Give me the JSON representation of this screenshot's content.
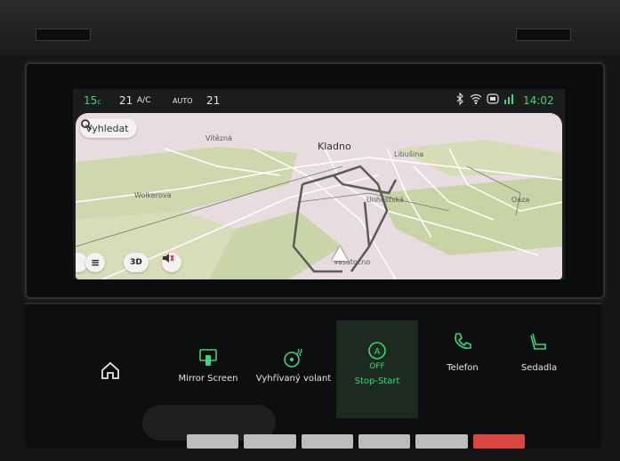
{
  "status_bar": {
    "outside_temp": "15",
    "outside_temp_unit": "c",
    "driver_temp": "21",
    "ac_label": "A/C",
    "auto_label": "AUTO",
    "passenger_temp": "21",
    "clock": "14:02",
    "icons": [
      "bluetooth-icon",
      "wifi-icon",
      "car-connect-icon",
      "signal-icon"
    ]
  },
  "map": {
    "search_label": "Vyhledat",
    "places": [
      "Vítězná",
      "Kladno",
      "Libušina",
      "Wolkerova",
      "Unhošťská",
      "Oaza",
      "Vašatočno"
    ],
    "buttons": {
      "menu": "≡",
      "view_mode": "3D"
    },
    "colors": {
      "land": "#e7dde0",
      "park": "#c8d3a4",
      "road": "#ffffff",
      "route": "#5a5a5a"
    }
  },
  "bottom_bar": {
    "home_icon": "home-icon",
    "tiles": [
      {
        "label": "Mirror Screen",
        "icon": "mirror-screen-icon"
      },
      {
        "label": "Vyhřívaný volant",
        "icon": "heated-steering-icon"
      },
      {
        "label": "Stop-Start",
        "state": "OFF",
        "icon": "stop-start-icon"
      },
      {
        "label": "Telefon",
        "icon": "phone-icon"
      },
      {
        "label": "Sedadla",
        "icon": "seat-icon"
      }
    ],
    "accent": "#39d67a"
  }
}
